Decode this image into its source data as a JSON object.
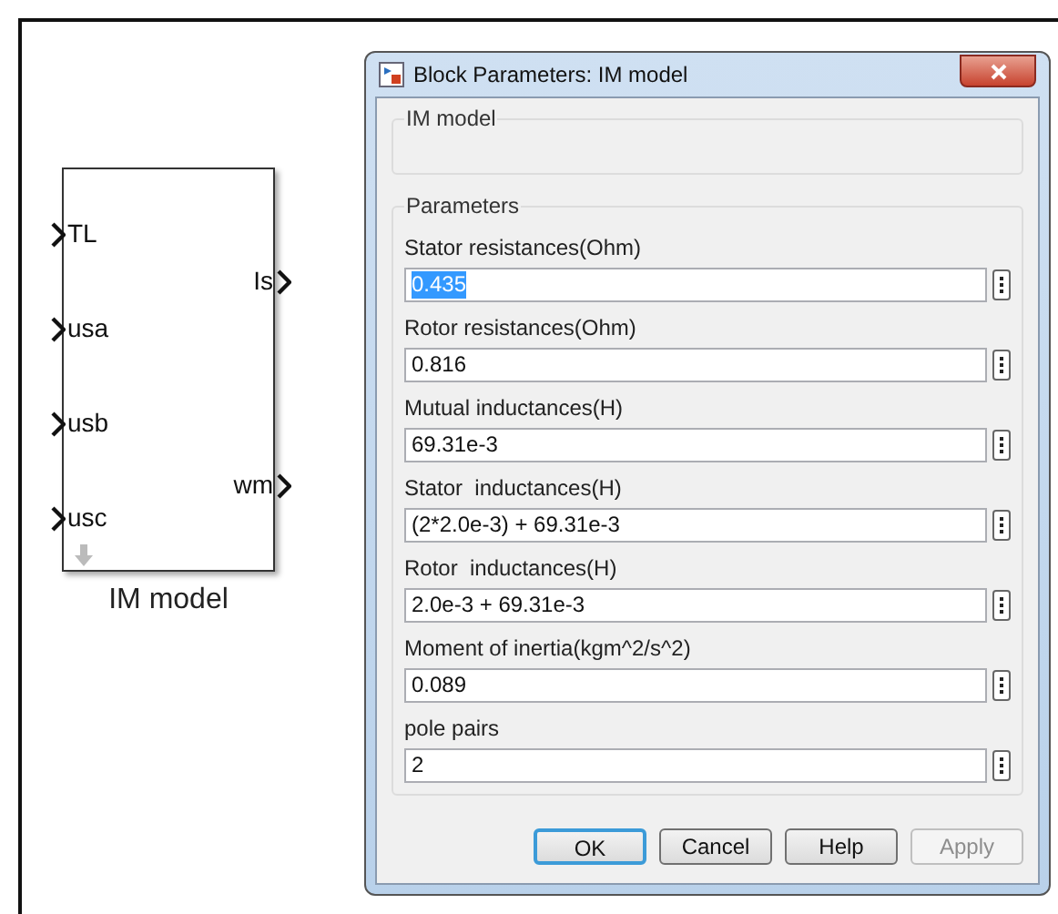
{
  "diagram": {
    "block": {
      "name": "IM model",
      "inputs": [
        "TL",
        "usa",
        "usb",
        "usc"
      ],
      "outputs": [
        "Is",
        "wm"
      ]
    }
  },
  "dialog": {
    "title": "Block Parameters: IM model",
    "description_group": {
      "title": "IM model"
    },
    "parameters_group": {
      "title": "Parameters",
      "fields": [
        {
          "label": "Stator resistances(Ohm)",
          "value": "0.435",
          "text_selected": true
        },
        {
          "label": "Rotor resistances(Ohm)",
          "value": "0.816",
          "text_selected": false
        },
        {
          "label": "Mutual inductances(H)",
          "value": "69.31e-3",
          "text_selected": false
        },
        {
          "label": "Stator  inductances(H)",
          "value": "(2*2.0e-3) + 69.31e-3",
          "text_selected": false
        },
        {
          "label": "Rotor  inductances(H)",
          "value": "2.0e-3 + 69.31e-3",
          "text_selected": false
        },
        {
          "label": "Moment of inertia(kgm^2/s^2)",
          "value": "0.089",
          "text_selected": false
        },
        {
          "label": "pole pairs",
          "value": "2",
          "text_selected": false
        }
      ]
    },
    "buttons": [
      {
        "label": "OK",
        "default": true,
        "disabled": false
      },
      {
        "label": "Cancel",
        "default": false,
        "disabled": false
      },
      {
        "label": "Help",
        "default": false,
        "disabled": false
      },
      {
        "label": "Apply",
        "default": false,
        "disabled": true
      }
    ]
  }
}
